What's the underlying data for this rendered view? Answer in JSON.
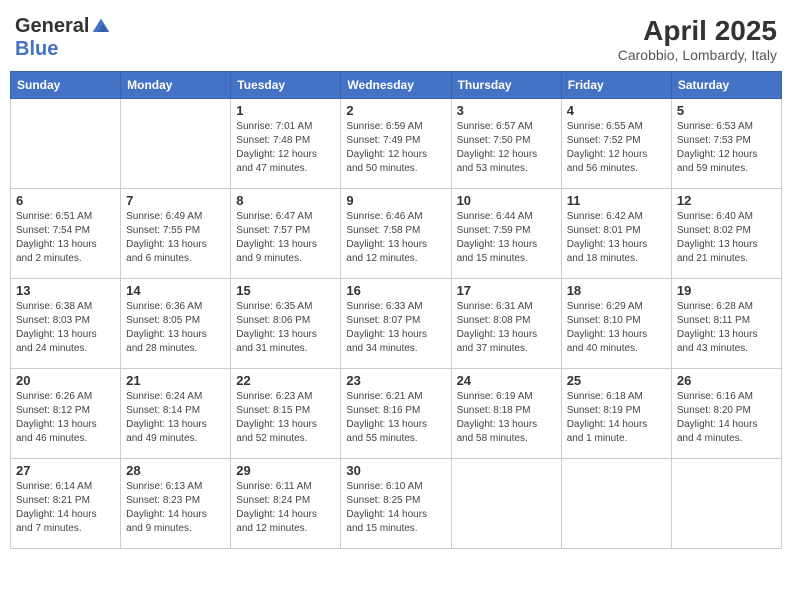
{
  "header": {
    "logo_general": "General",
    "logo_blue": "Blue",
    "month_year": "April 2025",
    "location": "Carobbio, Lombardy, Italy"
  },
  "weekdays": [
    "Sunday",
    "Monday",
    "Tuesday",
    "Wednesday",
    "Thursday",
    "Friday",
    "Saturday"
  ],
  "weeks": [
    [
      {
        "day": "",
        "info": ""
      },
      {
        "day": "",
        "info": ""
      },
      {
        "day": "1",
        "info": "Sunrise: 7:01 AM\nSunset: 7:48 PM\nDaylight: 12 hours and 47 minutes."
      },
      {
        "day": "2",
        "info": "Sunrise: 6:59 AM\nSunset: 7:49 PM\nDaylight: 12 hours and 50 minutes."
      },
      {
        "day": "3",
        "info": "Sunrise: 6:57 AM\nSunset: 7:50 PM\nDaylight: 12 hours and 53 minutes."
      },
      {
        "day": "4",
        "info": "Sunrise: 6:55 AM\nSunset: 7:52 PM\nDaylight: 12 hours and 56 minutes."
      },
      {
        "day": "5",
        "info": "Sunrise: 6:53 AM\nSunset: 7:53 PM\nDaylight: 12 hours and 59 minutes."
      }
    ],
    [
      {
        "day": "6",
        "info": "Sunrise: 6:51 AM\nSunset: 7:54 PM\nDaylight: 13 hours and 2 minutes."
      },
      {
        "day": "7",
        "info": "Sunrise: 6:49 AM\nSunset: 7:55 PM\nDaylight: 13 hours and 6 minutes."
      },
      {
        "day": "8",
        "info": "Sunrise: 6:47 AM\nSunset: 7:57 PM\nDaylight: 13 hours and 9 minutes."
      },
      {
        "day": "9",
        "info": "Sunrise: 6:46 AM\nSunset: 7:58 PM\nDaylight: 13 hours and 12 minutes."
      },
      {
        "day": "10",
        "info": "Sunrise: 6:44 AM\nSunset: 7:59 PM\nDaylight: 13 hours and 15 minutes."
      },
      {
        "day": "11",
        "info": "Sunrise: 6:42 AM\nSunset: 8:01 PM\nDaylight: 13 hours and 18 minutes."
      },
      {
        "day": "12",
        "info": "Sunrise: 6:40 AM\nSunset: 8:02 PM\nDaylight: 13 hours and 21 minutes."
      }
    ],
    [
      {
        "day": "13",
        "info": "Sunrise: 6:38 AM\nSunset: 8:03 PM\nDaylight: 13 hours and 24 minutes."
      },
      {
        "day": "14",
        "info": "Sunrise: 6:36 AM\nSunset: 8:05 PM\nDaylight: 13 hours and 28 minutes."
      },
      {
        "day": "15",
        "info": "Sunrise: 6:35 AM\nSunset: 8:06 PM\nDaylight: 13 hours and 31 minutes."
      },
      {
        "day": "16",
        "info": "Sunrise: 6:33 AM\nSunset: 8:07 PM\nDaylight: 13 hours and 34 minutes."
      },
      {
        "day": "17",
        "info": "Sunrise: 6:31 AM\nSunset: 8:08 PM\nDaylight: 13 hours and 37 minutes."
      },
      {
        "day": "18",
        "info": "Sunrise: 6:29 AM\nSunset: 8:10 PM\nDaylight: 13 hours and 40 minutes."
      },
      {
        "day": "19",
        "info": "Sunrise: 6:28 AM\nSunset: 8:11 PM\nDaylight: 13 hours and 43 minutes."
      }
    ],
    [
      {
        "day": "20",
        "info": "Sunrise: 6:26 AM\nSunset: 8:12 PM\nDaylight: 13 hours and 46 minutes."
      },
      {
        "day": "21",
        "info": "Sunrise: 6:24 AM\nSunset: 8:14 PM\nDaylight: 13 hours and 49 minutes."
      },
      {
        "day": "22",
        "info": "Sunrise: 6:23 AM\nSunset: 8:15 PM\nDaylight: 13 hours and 52 minutes."
      },
      {
        "day": "23",
        "info": "Sunrise: 6:21 AM\nSunset: 8:16 PM\nDaylight: 13 hours and 55 minutes."
      },
      {
        "day": "24",
        "info": "Sunrise: 6:19 AM\nSunset: 8:18 PM\nDaylight: 13 hours and 58 minutes."
      },
      {
        "day": "25",
        "info": "Sunrise: 6:18 AM\nSunset: 8:19 PM\nDaylight: 14 hours and 1 minute."
      },
      {
        "day": "26",
        "info": "Sunrise: 6:16 AM\nSunset: 8:20 PM\nDaylight: 14 hours and 4 minutes."
      }
    ],
    [
      {
        "day": "27",
        "info": "Sunrise: 6:14 AM\nSunset: 8:21 PM\nDaylight: 14 hours and 7 minutes."
      },
      {
        "day": "28",
        "info": "Sunrise: 6:13 AM\nSunset: 8:23 PM\nDaylight: 14 hours and 9 minutes."
      },
      {
        "day": "29",
        "info": "Sunrise: 6:11 AM\nSunset: 8:24 PM\nDaylight: 14 hours and 12 minutes."
      },
      {
        "day": "30",
        "info": "Sunrise: 6:10 AM\nSunset: 8:25 PM\nDaylight: 14 hours and 15 minutes."
      },
      {
        "day": "",
        "info": ""
      },
      {
        "day": "",
        "info": ""
      },
      {
        "day": "",
        "info": ""
      }
    ]
  ]
}
